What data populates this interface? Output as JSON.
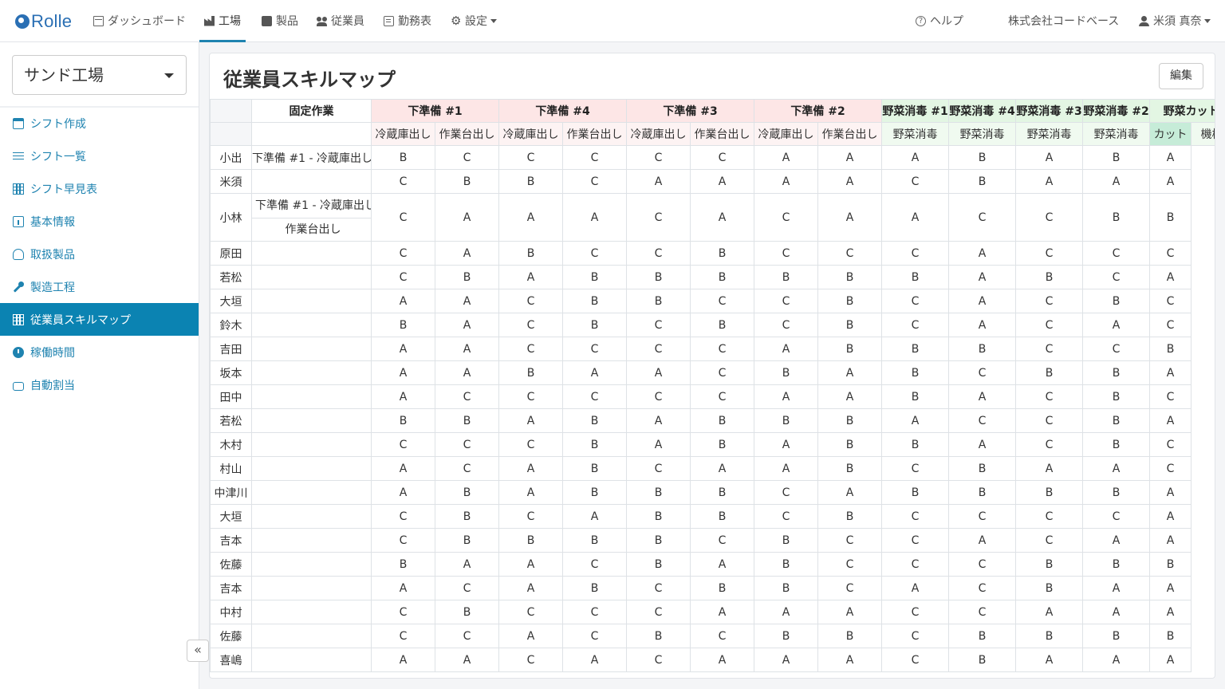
{
  "app": {
    "logo": "Rolle"
  },
  "nav": {
    "items": [
      {
        "label": "ダッシュボード",
        "icon": "grid-icon"
      },
      {
        "label": "工場",
        "icon": "factory-icon"
      },
      {
        "label": "製品",
        "icon": "box-icon"
      },
      {
        "label": "従業員",
        "icon": "users-icon"
      },
      {
        "label": "勤務表",
        "icon": "document-icon"
      },
      {
        "label": "設定",
        "icon": "gear-icon"
      }
    ],
    "active": "工場",
    "help": "ヘルプ",
    "company": "株式会社コードベース",
    "user": "米須 真奈"
  },
  "sidebar": {
    "factory": "サンド工場",
    "items": [
      {
        "label": "シフト作成",
        "icon": "calendar-plus-icon"
      },
      {
        "label": "シフト一覧",
        "icon": "list-icon"
      },
      {
        "label": "シフト早見表",
        "icon": "table-icon"
      },
      {
        "label": "基本情報",
        "icon": "info-icon"
      },
      {
        "label": "取扱製品",
        "icon": "cubes-icon"
      },
      {
        "label": "製造工程",
        "icon": "wrench-icon"
      },
      {
        "label": "従業員スキルマップ",
        "icon": "table-icon"
      },
      {
        "label": "稼働時間",
        "icon": "clock-icon"
      },
      {
        "label": "自動割当",
        "icon": "robot-icon"
      }
    ],
    "active": "従業員スキルマップ",
    "collapse": "«"
  },
  "main": {
    "title": "従業員スキルマップ",
    "edit": "編集",
    "fixed_header": "固定作業",
    "groups": [
      {
        "label": "下準備 #1",
        "subs": [
          "冷蔵庫出し",
          "作業台出し"
        ],
        "color": "red"
      },
      {
        "label": "下準備 #4",
        "subs": [
          "冷蔵庫出し",
          "作業台出し"
        ],
        "color": "red"
      },
      {
        "label": "下準備 #3",
        "subs": [
          "冷蔵庫出し",
          "作業台出し"
        ],
        "color": "red"
      },
      {
        "label": "下準備 #2",
        "subs": [
          "冷蔵庫出し",
          "作業台出し"
        ],
        "color": "red"
      },
      {
        "label": "野菜消毒 #1",
        "subs": [
          "野菜消毒"
        ],
        "color": "green"
      },
      {
        "label": "野菜消毒 #4",
        "subs": [
          "野菜消毒"
        ],
        "color": "green"
      },
      {
        "label": "野菜消毒 #3",
        "subs": [
          "野菜消毒"
        ],
        "color": "green"
      },
      {
        "label": "野菜消毒 #2",
        "subs": [
          "野菜消毒"
        ],
        "color": "green"
      },
      {
        "label": "野菜カット",
        "subs": [
          "カット",
          "機械"
        ],
        "color": "green"
      }
    ],
    "rows": [
      {
        "name": "小出",
        "fixed": [
          "下準備 #1 - 冷蔵庫出し"
        ],
        "skills": [
          "B",
          "C",
          "C",
          "C",
          "C",
          "C",
          "A",
          "A",
          "A",
          "B",
          "A",
          "B",
          "A"
        ]
      },
      {
        "name": "米須",
        "fixed": [],
        "skills": [
          "C",
          "B",
          "B",
          "C",
          "A",
          "A",
          "A",
          "A",
          "C",
          "B",
          "A",
          "A",
          "A"
        ]
      },
      {
        "name": "小林",
        "fixed": [
          "下準備 #1 - 冷蔵庫出し",
          "作業台出し"
        ],
        "skills": [
          "C",
          "A",
          "A",
          "A",
          "C",
          "A",
          "C",
          "A",
          "A",
          "C",
          "C",
          "B",
          "B"
        ]
      },
      {
        "name": "原田",
        "fixed": [],
        "skills": [
          "C",
          "A",
          "B",
          "C",
          "C",
          "B",
          "C",
          "C",
          "C",
          "A",
          "C",
          "C",
          "C"
        ]
      },
      {
        "name": "若松",
        "fixed": [],
        "skills": [
          "C",
          "B",
          "A",
          "B",
          "B",
          "B",
          "B",
          "B",
          "B",
          "A",
          "B",
          "C",
          "A"
        ]
      },
      {
        "name": "大垣",
        "fixed": [],
        "skills": [
          "A",
          "A",
          "C",
          "B",
          "B",
          "C",
          "C",
          "B",
          "C",
          "A",
          "C",
          "B",
          "C"
        ]
      },
      {
        "name": "鈴木",
        "fixed": [],
        "skills": [
          "B",
          "A",
          "C",
          "B",
          "C",
          "B",
          "C",
          "B",
          "C",
          "A",
          "C",
          "A",
          "C"
        ]
      },
      {
        "name": "吉田",
        "fixed": [],
        "skills": [
          "A",
          "A",
          "C",
          "C",
          "C",
          "C",
          "A",
          "B",
          "B",
          "B",
          "C",
          "C",
          "B"
        ]
      },
      {
        "name": "坂本",
        "fixed": [],
        "skills": [
          "A",
          "A",
          "B",
          "A",
          "A",
          "C",
          "B",
          "A",
          "B",
          "C",
          "B",
          "B",
          "A"
        ]
      },
      {
        "name": "田中",
        "fixed": [],
        "skills": [
          "A",
          "C",
          "C",
          "C",
          "C",
          "C",
          "A",
          "A",
          "B",
          "A",
          "C",
          "B",
          "C"
        ]
      },
      {
        "name": "若松",
        "fixed": [],
        "skills": [
          "B",
          "B",
          "A",
          "B",
          "A",
          "B",
          "B",
          "B",
          "A",
          "C",
          "C",
          "B",
          "A"
        ]
      },
      {
        "name": "木村",
        "fixed": [],
        "skills": [
          "C",
          "C",
          "C",
          "B",
          "A",
          "B",
          "A",
          "B",
          "B",
          "A",
          "C",
          "B",
          "C"
        ]
      },
      {
        "name": "村山",
        "fixed": [],
        "skills": [
          "A",
          "C",
          "A",
          "B",
          "C",
          "A",
          "A",
          "B",
          "C",
          "B",
          "A",
          "A",
          "C"
        ]
      },
      {
        "name": "中津川",
        "fixed": [],
        "skills": [
          "A",
          "B",
          "A",
          "B",
          "B",
          "B",
          "C",
          "A",
          "B",
          "B",
          "B",
          "B",
          "A"
        ]
      },
      {
        "name": "大垣",
        "fixed": [],
        "skills": [
          "C",
          "B",
          "C",
          "A",
          "B",
          "B",
          "C",
          "B",
          "C",
          "C",
          "C",
          "C",
          "A"
        ]
      },
      {
        "name": "吉本",
        "fixed": [],
        "skills": [
          "C",
          "B",
          "B",
          "B",
          "B",
          "C",
          "B",
          "C",
          "C",
          "A",
          "C",
          "A",
          "A"
        ]
      },
      {
        "name": "佐藤",
        "fixed": [],
        "skills": [
          "B",
          "A",
          "A",
          "C",
          "B",
          "A",
          "B",
          "C",
          "C",
          "C",
          "B",
          "B",
          "B"
        ]
      },
      {
        "name": "吉本",
        "fixed": [],
        "skills": [
          "A",
          "C",
          "A",
          "B",
          "C",
          "B",
          "B",
          "C",
          "A",
          "C",
          "B",
          "A",
          "A"
        ]
      },
      {
        "name": "中村",
        "fixed": [],
        "skills": [
          "C",
          "B",
          "C",
          "C",
          "C",
          "A",
          "A",
          "A",
          "C",
          "C",
          "A",
          "A",
          "A"
        ]
      },
      {
        "name": "佐藤",
        "fixed": [],
        "skills": [
          "C",
          "C",
          "A",
          "C",
          "B",
          "C",
          "B",
          "B",
          "C",
          "B",
          "B",
          "B",
          "B"
        ]
      },
      {
        "name": "喜嶋",
        "fixed": [],
        "skills": [
          "A",
          "A",
          "C",
          "A",
          "C",
          "A",
          "A",
          "A",
          "C",
          "B",
          "A",
          "A",
          "A"
        ]
      }
    ]
  },
  "colors": {
    "accent": "#1f83b0",
    "active_bg": "#0b83b2",
    "prep_header": "#fde6e6",
    "veg_header": "#e3f6e3",
    "cut_sub": "#c6ecd8"
  }
}
